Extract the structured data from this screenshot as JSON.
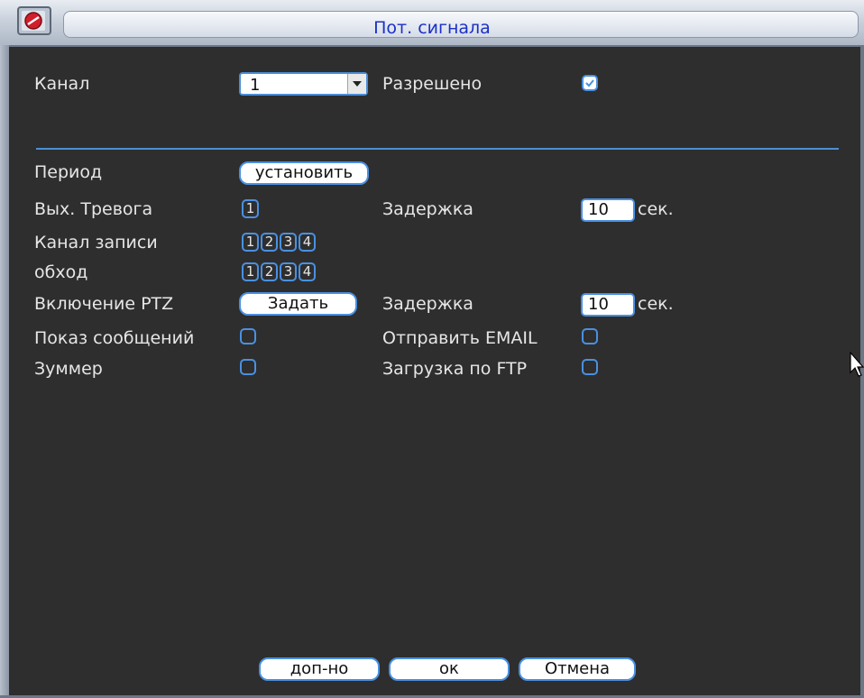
{
  "window": {
    "title": "Пот. сигнала"
  },
  "channel": {
    "label": "Канал",
    "value": "1"
  },
  "enabled": {
    "label": "Разрешено",
    "checked": true
  },
  "period": {
    "label": "Период",
    "button": "установить"
  },
  "alarm_out": {
    "label": "Вых. Тревога",
    "boxes": [
      "1"
    ]
  },
  "delay1": {
    "label": "Задержка",
    "value": "10",
    "unit": "сек."
  },
  "record_channel": {
    "label": "Канал записи",
    "boxes": [
      "1",
      "2",
      "3",
      "4"
    ]
  },
  "tour": {
    "label": "обход",
    "boxes": [
      "1",
      "2",
      "3",
      "4"
    ]
  },
  "ptz": {
    "label": "Включение PTZ",
    "button": "Задать"
  },
  "delay2": {
    "label": "Задержка",
    "value": "10",
    "unit": "сек."
  },
  "show_message": {
    "label": "Показ сообщений",
    "checked": false
  },
  "send_email": {
    "label": "Отправить EMAIL",
    "checked": false
  },
  "buzzer": {
    "label": "Зуммер",
    "checked": false
  },
  "ftp_upload": {
    "label": "Загрузка по FTP",
    "checked": false
  },
  "footer": {
    "advanced": "доп-но",
    "ok": "ок",
    "cancel": "Отмена"
  },
  "colors": {
    "accent": "#4a90e2",
    "title_text": "#1a30c7",
    "background": "#2e2e2e"
  }
}
